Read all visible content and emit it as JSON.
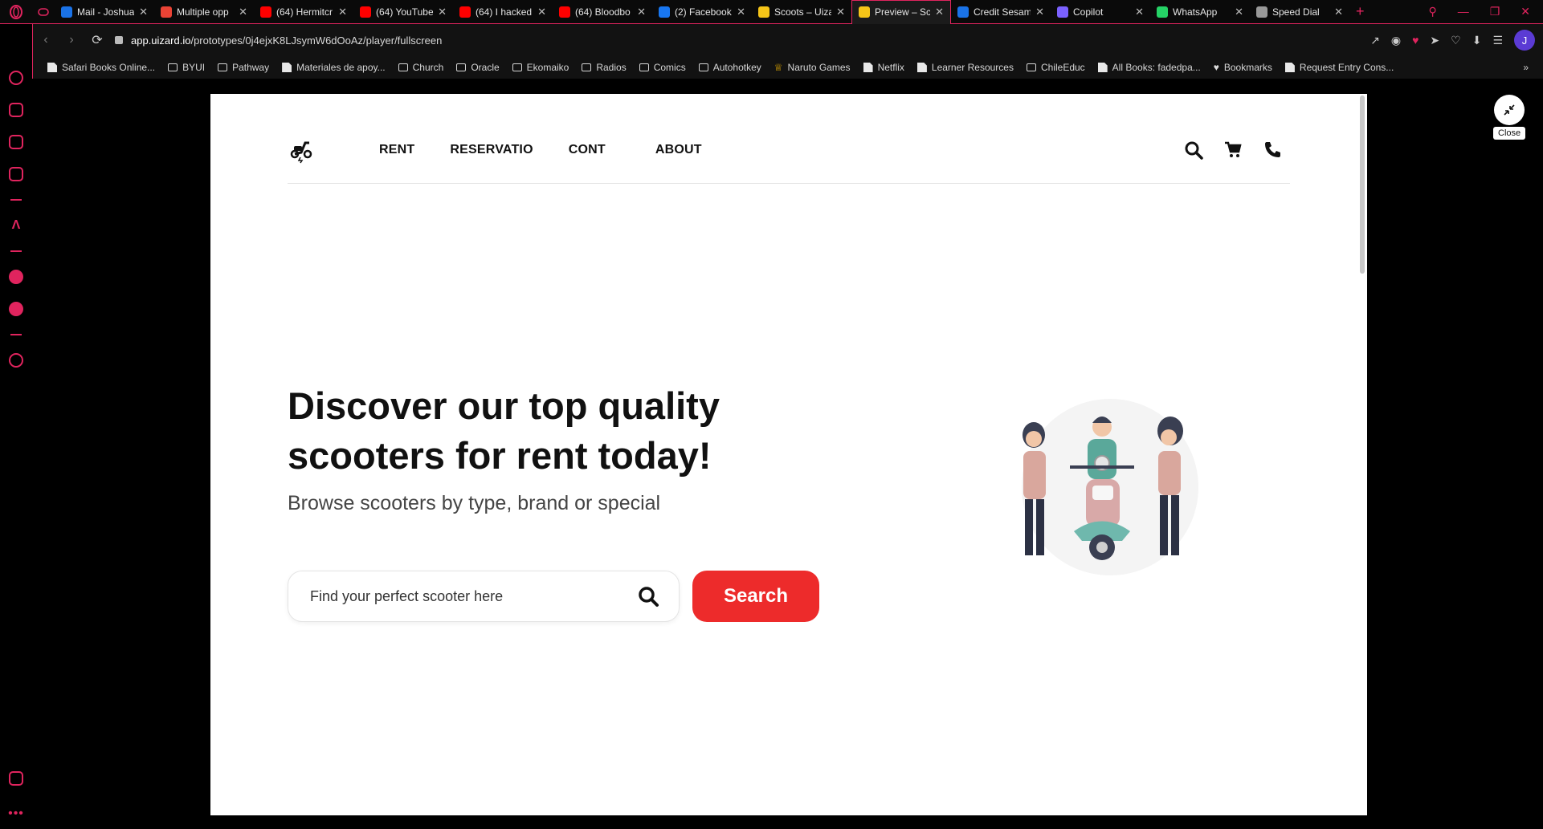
{
  "browser": {
    "tabs": [
      {
        "label": "Mail - Joshua",
        "color": "#1a73e8"
      },
      {
        "label": "Multiple opp",
        "color": "#ea4335"
      },
      {
        "label": "(64) Hermitcr",
        "color": "#ff0000"
      },
      {
        "label": "(64) YouTube",
        "color": "#ff0000"
      },
      {
        "label": "(64) I hacked",
        "color": "#ff0000"
      },
      {
        "label": "(64) Bloodbo",
        "color": "#ff0000"
      },
      {
        "label": "(2) Facebook",
        "color": "#1877f2"
      },
      {
        "label": "Scoots – Uiza",
        "color": "#f5c518"
      },
      {
        "label": "Preview – Sco",
        "color": "#f5c518",
        "active": true
      },
      {
        "label": "Credit Sesam",
        "color": "#1a73e8"
      },
      {
        "label": "Copilot",
        "color": "#7b61ff"
      },
      {
        "label": "WhatsApp",
        "color": "#25d366"
      },
      {
        "label": "Speed Dial",
        "color": "#999999"
      }
    ],
    "url_host": "app.uizard.io",
    "url_path": "/prototypes/0j4ejxK8LJsymW6dOoAz/player/fullscreen",
    "avatar_letter": "J",
    "bookmarks": [
      {
        "label": "Safari Books Online...",
        "type": "page"
      },
      {
        "label": "BYUI",
        "type": "folder"
      },
      {
        "label": "Pathway",
        "type": "folder"
      },
      {
        "label": "Materiales de apoy...",
        "type": "page"
      },
      {
        "label": "Church",
        "type": "folder"
      },
      {
        "label": "Oracle",
        "type": "folder"
      },
      {
        "label": "Ekomaiko",
        "type": "folder"
      },
      {
        "label": "Radios",
        "type": "folder"
      },
      {
        "label": "Comics",
        "type": "folder"
      },
      {
        "label": "Autohotkey",
        "type": "folder"
      },
      {
        "label": "Naruto Games",
        "type": "crown"
      },
      {
        "label": "Netflix",
        "type": "page"
      },
      {
        "label": "Learner Resources",
        "type": "page"
      },
      {
        "label": "ChileEduc",
        "type": "folder"
      },
      {
        "label": "All Books: fadedpa...",
        "type": "page"
      },
      {
        "label": "Bookmarks",
        "type": "heart"
      },
      {
        "label": "Request Entry Cons...",
        "type": "page"
      }
    ],
    "accent": "#e0245e"
  },
  "site": {
    "nav": [
      "RENT",
      "RESERVATIO",
      "CONT",
      "ABOUT"
    ],
    "hero_title": "Discover our top quality scooters for rent today!",
    "hero_subtitle": "Browse scooters by type, brand or special",
    "search_placeholder": "Find your perfect scooter here",
    "search_button": "Search",
    "brand_red": "#ed2b2b"
  },
  "fullscreen": {
    "close_tooltip": "Close"
  }
}
